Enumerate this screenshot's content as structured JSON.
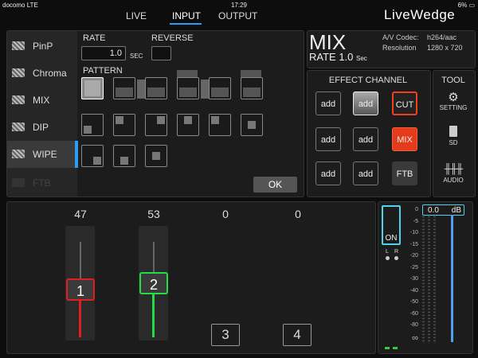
{
  "status": {
    "carrier": "docomo",
    "network": "LTE",
    "time": "17:29",
    "battery": "6%"
  },
  "nav": {
    "tabs": [
      "LIVE",
      "INPUT",
      "OUTPUT"
    ],
    "active": "INPUT",
    "brand": "LiveWedge"
  },
  "sidebar": {
    "items": [
      {
        "label": "PinP",
        "state": "normal"
      },
      {
        "label": "Chroma",
        "state": "normal"
      },
      {
        "label": "MIX",
        "state": "normal"
      },
      {
        "label": "DIP",
        "state": "normal"
      },
      {
        "label": "WIPE",
        "state": "selected"
      },
      {
        "label": "FTB",
        "state": "disabled"
      }
    ]
  },
  "wipe": {
    "rate_label": "RATE",
    "rate_value": "1.0",
    "rate_unit": "SEC",
    "reverse_label": "REVERSE",
    "pattern_label": "PATTERN",
    "ok_label": "OK"
  },
  "mix": {
    "title": "MIX",
    "rate_text": "RATE 1.0",
    "rate_unit": "Sec",
    "codec_label": "A/V Codec:",
    "codec_value": "h264/aac",
    "resolution_label": "Resolution",
    "resolution_value": "1280 x 720"
  },
  "effect": {
    "title": "EFFECT CHANNEL",
    "buttons": [
      {
        "label": "add",
        "style": "normal"
      },
      {
        "label": "add",
        "style": "active"
      },
      {
        "label": "CUT",
        "style": "cut"
      },
      {
        "label": "add",
        "style": "normal"
      },
      {
        "label": "add",
        "style": "normal"
      },
      {
        "label": "MIX",
        "style": "mix"
      },
      {
        "label": "add",
        "style": "normal"
      },
      {
        "label": "add",
        "style": "normal"
      },
      {
        "label": "FTB",
        "style": "ftb"
      }
    ]
  },
  "tool": {
    "title": "TOOL",
    "items": [
      {
        "label": "SETTING",
        "icon": "gear-icon"
      },
      {
        "label": "SD",
        "icon": "sd-card-icon"
      },
      {
        "label": "AUDIO",
        "icon": "mixer-icon"
      }
    ]
  },
  "inputs": [
    {
      "level": "47",
      "label": "1",
      "color": "#e02020",
      "fill": 0.45
    },
    {
      "level": "53",
      "label": "2",
      "color": "#22dd44",
      "fill": 0.53
    },
    {
      "level": "0",
      "label": "3"
    },
    {
      "level": "0",
      "label": "4"
    }
  ],
  "audio": {
    "on_label": "ON",
    "l_label": "L",
    "r_label": "R",
    "db_value": "0.0",
    "db_unit": "dB",
    "scale": [
      "0",
      "-5",
      "-10",
      "-15",
      "-20",
      "-25",
      "-30",
      "-40",
      "-50",
      "-60",
      "-80",
      "∞"
    ],
    "level": 1.0
  }
}
